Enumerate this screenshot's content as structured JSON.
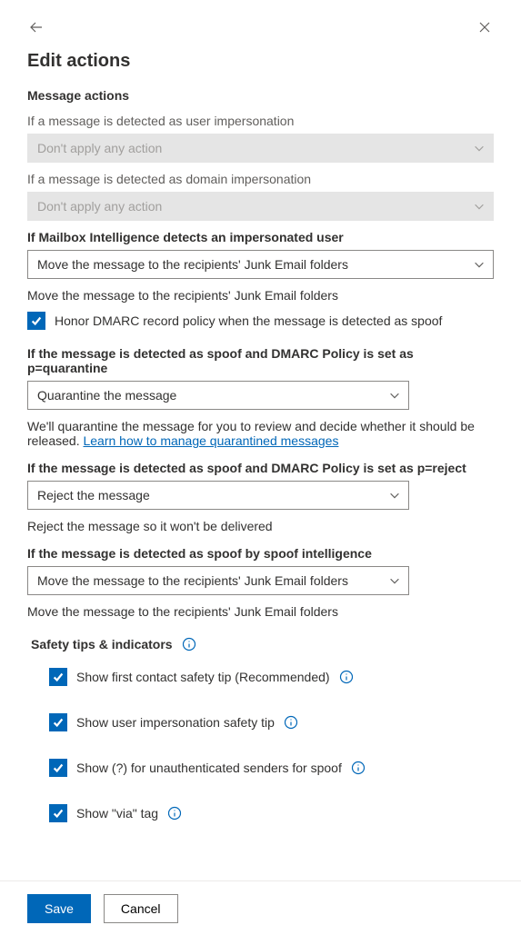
{
  "header": {
    "title": "Edit actions"
  },
  "sections": {
    "message_actions": "Message actions",
    "safety_tips": "Safety tips & indicators"
  },
  "fields": {
    "user_impersonation": {
      "label": "If a message is detected as user impersonation",
      "value": "Don't apply any action"
    },
    "domain_impersonation": {
      "label": "If a message is detected as domain impersonation",
      "value": "Don't apply any action"
    },
    "mailbox_intelligence": {
      "label": "If Mailbox Intelligence detects an impersonated user",
      "value": "Move the message to the recipients' Junk Email folders",
      "helper": "Move the message to the recipients' Junk Email folders"
    },
    "honor_dmarc": {
      "label": "Honor DMARC record policy when the message is detected as spoof"
    },
    "dmarc_quarantine": {
      "label": "If the message is detected as spoof and DMARC Policy is set as p=quarantine",
      "value": "Quarantine the message",
      "helper": "We'll quarantine the message for you to review and decide whether it should be released. ",
      "helper_link": "Learn how to manage quarantined messages"
    },
    "dmarc_reject": {
      "label": "If the message is detected as spoof and DMARC Policy is set as p=reject",
      "value": "Reject the message",
      "helper": "Reject the message so it won't be delivered"
    },
    "spoof_intelligence": {
      "label": "If the message is detected as spoof by spoof intelligence",
      "value": "Move the message to the recipients' Junk Email folders",
      "helper": "Move the message to the recipients' Junk Email folders"
    }
  },
  "safety": {
    "first_contact": "Show first contact safety tip (Recommended)",
    "user_impersonation_tip": "Show user impersonation safety tip",
    "unauth_senders": "Show (?) for unauthenticated senders for spoof",
    "via_tag": "Show \"via\" tag"
  },
  "footer": {
    "save": "Save",
    "cancel": "Cancel"
  }
}
